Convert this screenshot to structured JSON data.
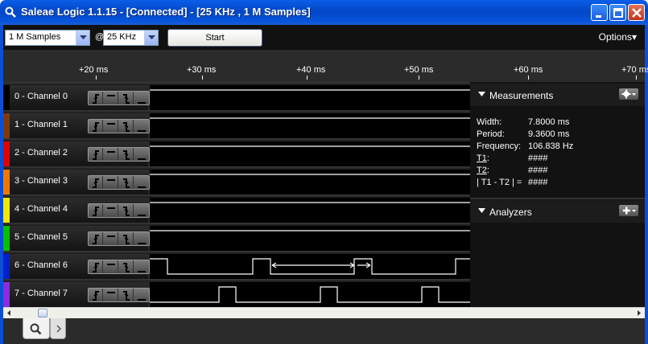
{
  "window": {
    "title": "Saleae Logic 1.1.15 - [Connected] - [25 KHz , 1 M Samples]"
  },
  "toolbar": {
    "samples_value": "1 M Samples",
    "at_label": "@",
    "rate_value": "25 KHz",
    "start_label": "Start",
    "options_label": "Options",
    "options_arrow": "▾"
  },
  "ruler": {
    "ticks": [
      "+20 ms",
      "+30 ms",
      "+40 ms",
      "+50 ms",
      "+60 ms",
      "+70 ms"
    ]
  },
  "channels": [
    {
      "label": "0 - Channel 0",
      "color": "#000000"
    },
    {
      "label": "1 - Channel 1",
      "color": "#7a3b10"
    },
    {
      "label": "2 - Channel 2",
      "color": "#e00000"
    },
    {
      "label": "3 - Channel 3",
      "color": "#f07800"
    },
    {
      "label": "4 - Channel 4",
      "color": "#f0e800"
    },
    {
      "label": "5 - Channel 5",
      "color": "#00c000"
    },
    {
      "label": "6 - Channel 6",
      "color": "#0020d0"
    },
    {
      "label": "7 - Channel 7",
      "color": "#8a2be2"
    }
  ],
  "measurements": {
    "title": "Measurements",
    "width_label": "Width:",
    "width_value": "7.8000 ms",
    "period_label": "Period:",
    "period_value": "9.3600 ms",
    "frequency_label": "Frequency:",
    "frequency_value": "106.838 Hz",
    "t1_label": "T1",
    "t1_colon": ":",
    "t1_value": "####",
    "t2_label": "T2",
    "t2_colon": ":",
    "t2_value": "####",
    "diff_label": "| T1 - T2 | =",
    "diff_value": "####"
  },
  "analyzers": {
    "title": "Analyzers"
  },
  "icons": {
    "app": "magnifier-icon",
    "minimize": "minimize-icon",
    "maximize": "maximize-icon",
    "close": "close-icon"
  }
}
